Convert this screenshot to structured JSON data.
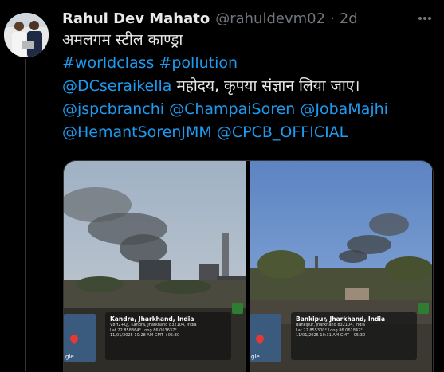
{
  "tweet": {
    "author_name": "Rahul Dev Mahato",
    "handle": "@rahuldevm02",
    "separator": "·",
    "time": "2d",
    "more_icon": "more-dots-icon",
    "text_line1": "अमलगम स्टील काण्ड्रा",
    "hashtags": [
      "#worldclass",
      "#pollution"
    ],
    "mention_dc": "@DCseraikella",
    "request_text": "महोदय, कृपया संज्ञान लिया जाए।",
    "mentions_line1": [
      "@jspcbranchi",
      "@ChampaiSoren",
      "@JobaMajhi"
    ],
    "mentions_line2": [
      "@HemantSorenJMM",
      "@CPCB_OFFICIAL"
    ]
  },
  "media": [
    {
      "location_title": "Kandra, Jharkhand, India",
      "detail_lines": [
        "V8H2+QJ, Kandra, Jharkhand 832104, India",
        "Lat 22.858864° Long 86.063637°",
        "11/01/2025 10:28 AM GMT +05:30"
      ],
      "map_label": "gle"
    },
    {
      "location_title": "Bankipur, Jharkhand, India",
      "detail_lines": [
        "Bankipur, Jharkhand 832104, India",
        "Lat 22.855300° Long 86.061847°",
        "11/01/2025 10:31 AM GMT +05:30"
      ],
      "map_label": "gle"
    }
  ],
  "colors": {
    "link": "#1d9bf0",
    "text": "#e7e9ea",
    "muted": "#71767b",
    "background": "#000000"
  }
}
